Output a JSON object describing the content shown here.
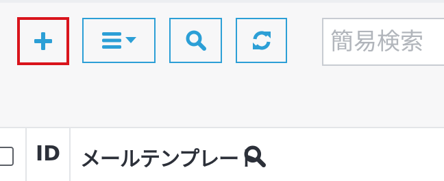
{
  "colors": {
    "accent": "#2c9fd6",
    "highlight_border": "#d9141c",
    "header_text": "#2c3039"
  },
  "toolbar": {
    "add_icon": "plus-icon",
    "menu_icon": "list-dropdown-icon",
    "search_icon": "search-icon",
    "refresh_icon": "refresh-icon",
    "quick_search_placeholder": "簡易検索"
  },
  "table": {
    "columns": [
      {
        "label": ""
      },
      {
        "label": "ID"
      },
      {
        "label": "メールテンプレート"
      }
    ]
  }
}
